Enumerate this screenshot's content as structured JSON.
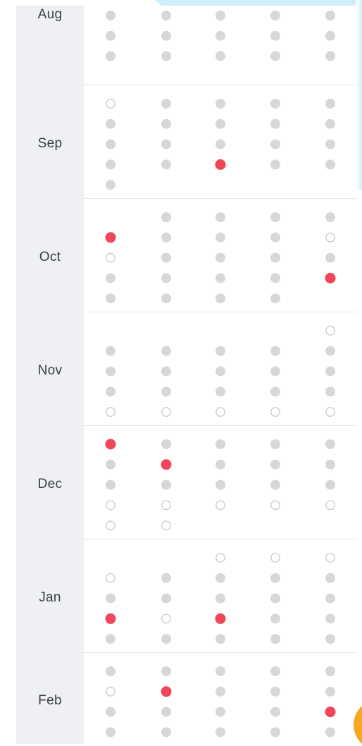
{
  "calendar": {
    "colors": {
      "neutral": "#d6d7d9",
      "highlight": "#f0465a",
      "empty_stroke": "#c2c4c7",
      "label_bg": "#eef0f3"
    },
    "legend_codes": {
      "g": "neutral filled dot",
      "r": "highlighted red dot",
      "o": "empty outlined dot",
      "_": "no dot"
    },
    "months": [
      {
        "label": "Aug",
        "rows": [
          [
            "g",
            "g",
            "g",
            "g",
            "g"
          ],
          [
            "g",
            "g",
            "g",
            "g",
            "g"
          ],
          [
            "g",
            "g",
            "g",
            "g",
            "g"
          ]
        ]
      },
      {
        "label": "Sep",
        "rows": [
          [
            "o",
            "g",
            "g",
            "g",
            "g"
          ],
          [
            "g",
            "g",
            "g",
            "g",
            "g"
          ],
          [
            "g",
            "g",
            "g",
            "g",
            "g"
          ],
          [
            "g",
            "g",
            "r",
            "g",
            "g"
          ],
          [
            "g",
            "_",
            "_",
            "_",
            "_"
          ]
        ]
      },
      {
        "label": "Oct",
        "rows": [
          [
            "_",
            "g",
            "g",
            "g",
            "g"
          ],
          [
            "r",
            "g",
            "g",
            "g",
            "o"
          ],
          [
            "o",
            "g",
            "g",
            "g",
            "g"
          ],
          [
            "g",
            "g",
            "g",
            "g",
            "r"
          ],
          [
            "g",
            "g",
            "g",
            "g",
            "_"
          ]
        ]
      },
      {
        "label": "Nov",
        "rows": [
          [
            "_",
            "_",
            "_",
            "_",
            "o"
          ],
          [
            "g",
            "g",
            "g",
            "g",
            "g"
          ],
          [
            "g",
            "g",
            "g",
            "g",
            "g"
          ],
          [
            "g",
            "g",
            "g",
            "g",
            "g"
          ],
          [
            "o",
            "o",
            "o",
            "o",
            "o"
          ]
        ]
      },
      {
        "label": "Dec",
        "rows": [
          [
            "r",
            "g",
            "g",
            "g",
            "g"
          ],
          [
            "g",
            "r",
            "g",
            "g",
            "g"
          ],
          [
            "g",
            "g",
            "g",
            "g",
            "g"
          ],
          [
            "o",
            "o",
            "o",
            "o",
            "o"
          ],
          [
            "o",
            "o",
            "_",
            "_",
            "_"
          ]
        ]
      },
      {
        "label": "Jan",
        "rows": [
          [
            "_",
            "_",
            "o",
            "o",
            "o"
          ],
          [
            "o",
            "g",
            "g",
            "g",
            "g"
          ],
          [
            "g",
            "g",
            "g",
            "g",
            "g"
          ],
          [
            "r",
            "o",
            "r",
            "g",
            "g"
          ],
          [
            "g",
            "g",
            "g",
            "g",
            "g"
          ]
        ]
      },
      {
        "label": "Feb",
        "rows": [
          [
            "g",
            "g",
            "g",
            "g",
            "g"
          ],
          [
            "o",
            "r",
            "g",
            "g",
            "g"
          ],
          [
            "g",
            "g",
            "g",
            "g",
            "r"
          ],
          [
            "g",
            "g",
            "g",
            "g",
            "g"
          ]
        ]
      }
    ]
  }
}
